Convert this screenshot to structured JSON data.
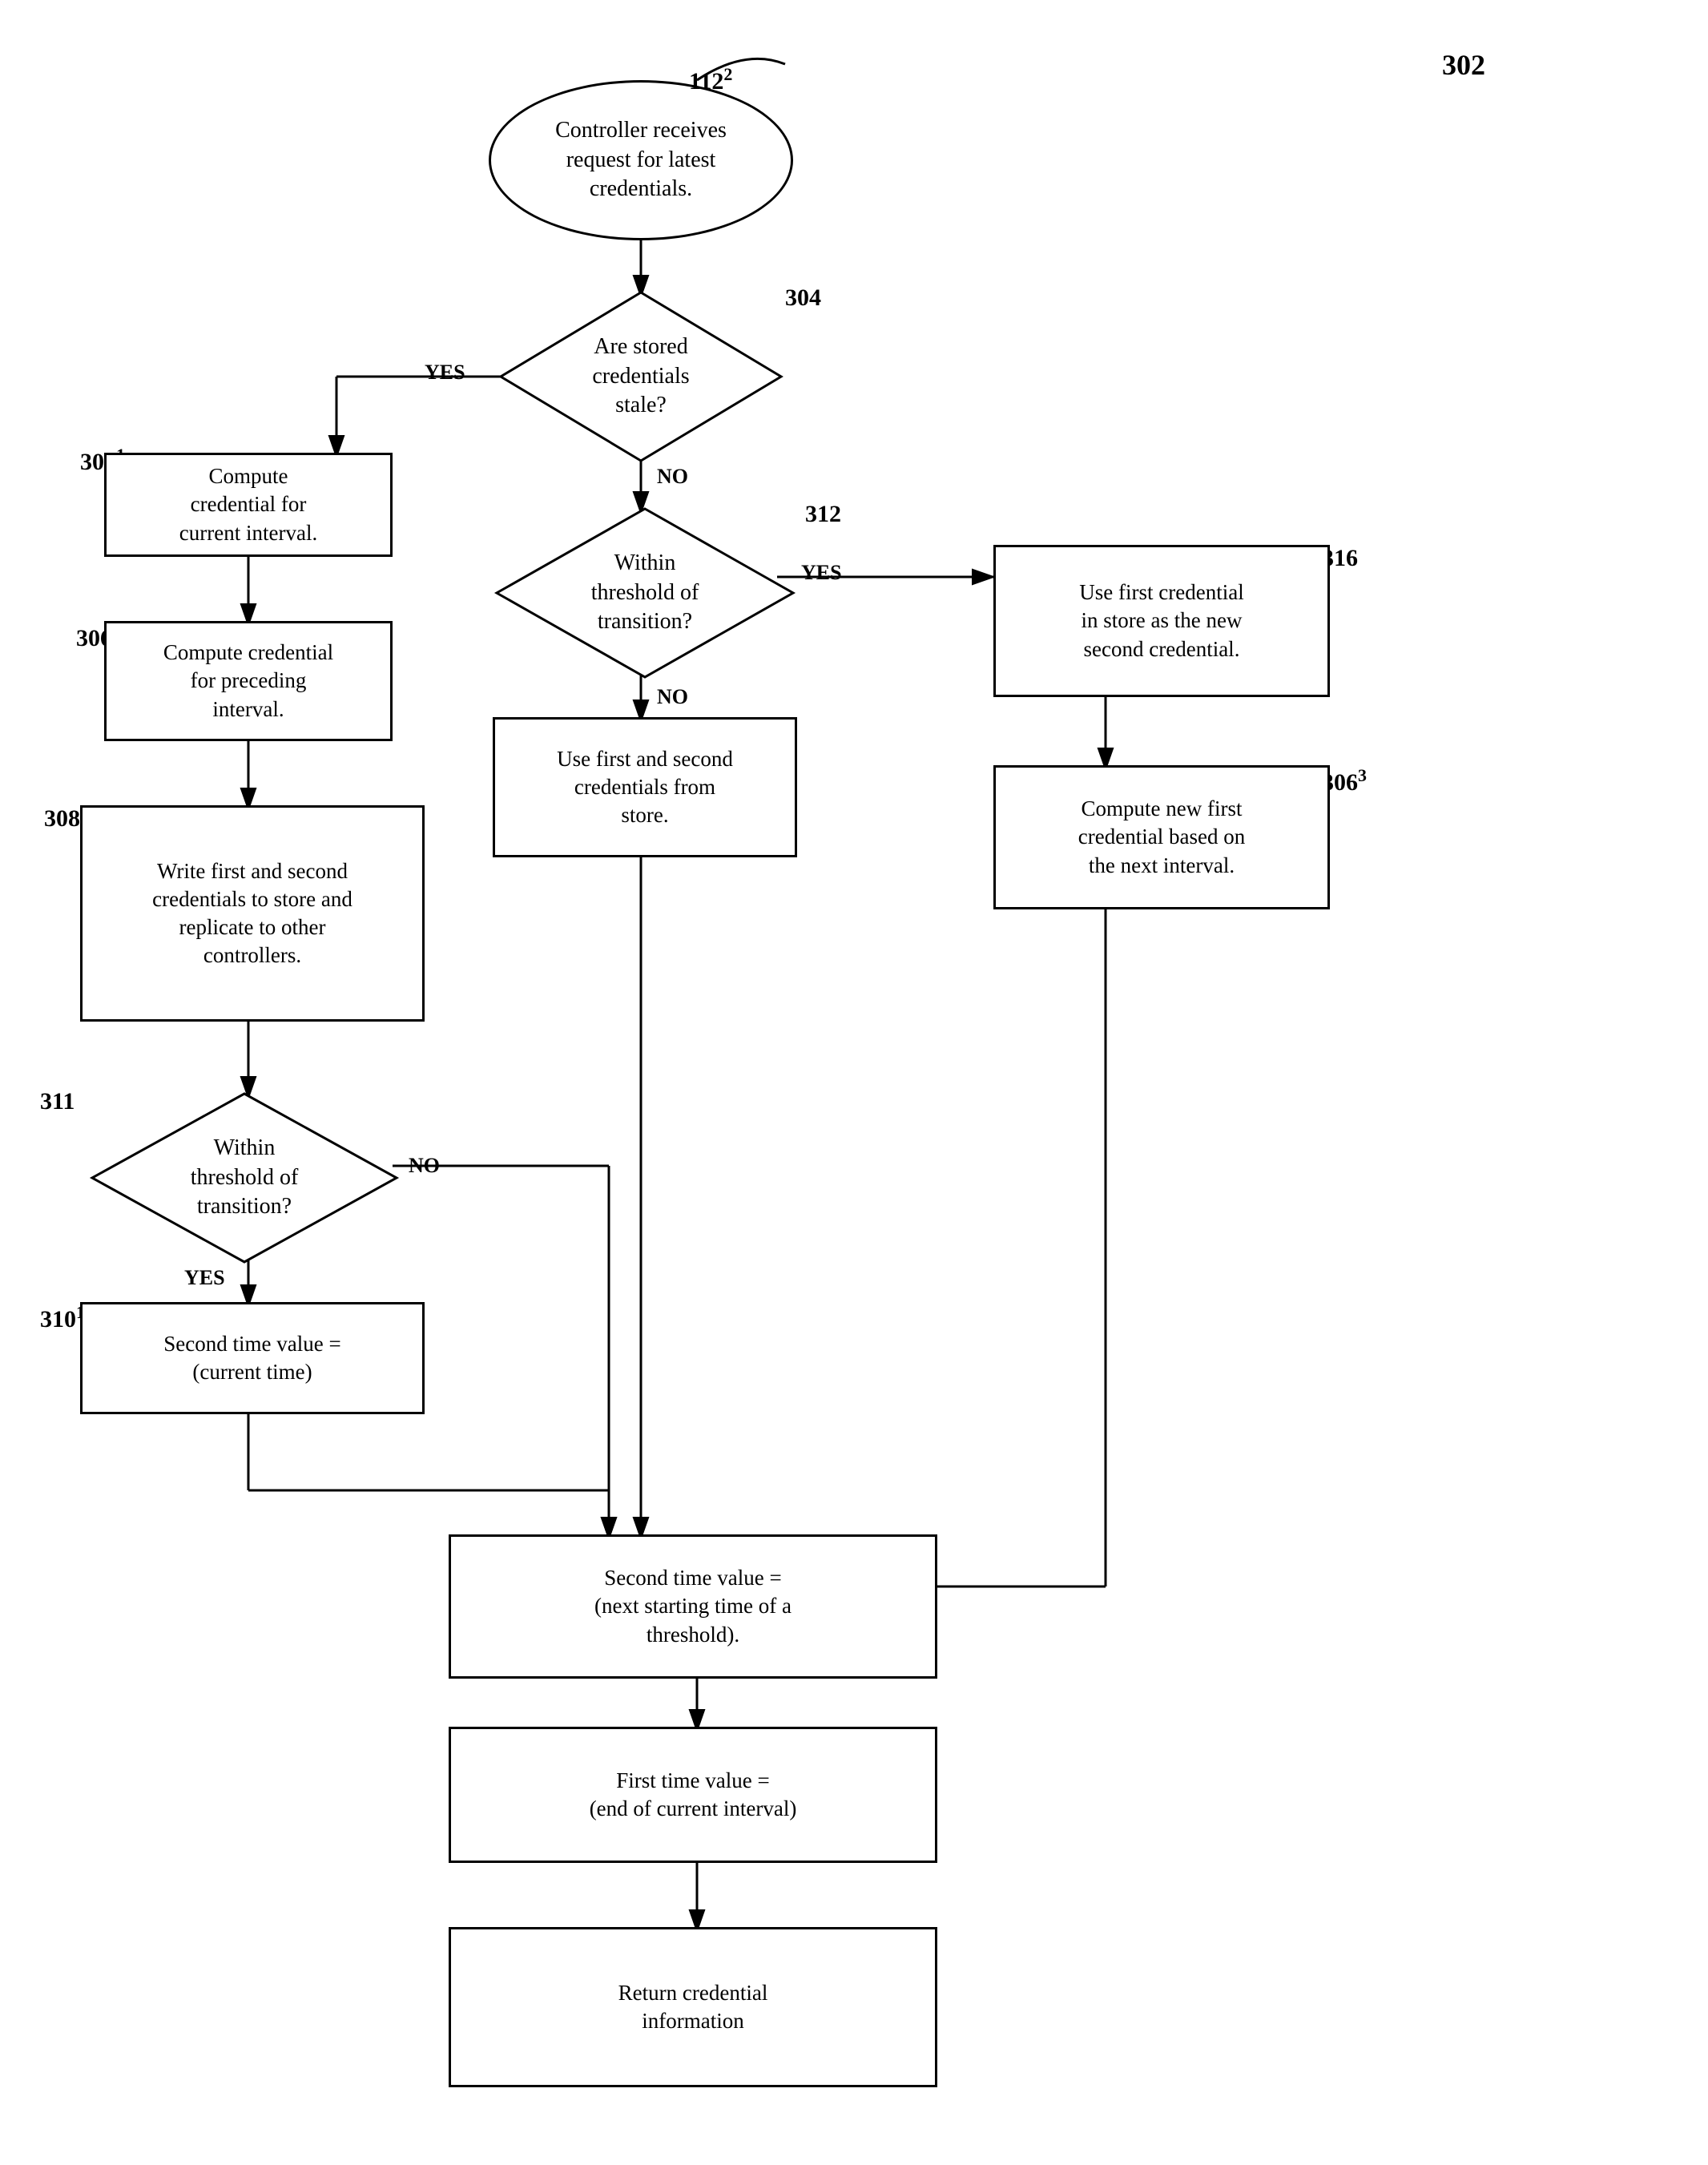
{
  "diagram": {
    "title": "Flowchart 302",
    "nodes": {
      "start": {
        "label": "Controller receives\nrequest for latest\ncredentials.",
        "id": "112_2",
        "type": "oval"
      },
      "d304": {
        "label": "Are stored\ncredentials\nstale?",
        "id": "304",
        "type": "diamond"
      },
      "b306_1": {
        "label": "Compute\ncredential for\ncurrent interval.",
        "id": "306_1",
        "type": "rect"
      },
      "b306_2": {
        "label": "Compute credential\nfor preceding\ninterval.",
        "id": "306_2",
        "type": "rect"
      },
      "b308": {
        "label": "Write first and second\ncredentials to store and\nreplicate to other\ncontrollers.",
        "id": "308",
        "type": "rect"
      },
      "d311": {
        "label": "Within\nthreshold of\ntransition?",
        "id": "311",
        "type": "diamond"
      },
      "b310_1": {
        "label": "Second time value =\n(current time)",
        "id": "310_1",
        "type": "rect"
      },
      "d312": {
        "label": "Within\nthreshold of\ntransition?",
        "id": "312",
        "type": "diamond"
      },
      "b314": {
        "label": "Use first and second\ncredentials from\nstore.",
        "id": "314",
        "type": "rect"
      },
      "b316": {
        "label": "Use first credential\nin store as the new\nsecond credential.",
        "id": "316",
        "type": "rect"
      },
      "b306_3": {
        "label": "Compute new first\ncredential based on\nthe next interval.",
        "id": "306_3",
        "type": "rect"
      },
      "b310_2": {
        "label": "Second time value =\n(next starting time of a\nthreshold).",
        "id": "310_2",
        "type": "rect"
      },
      "b309": {
        "label": "First time value =\n(end of current interval)",
        "id": "309",
        "type": "rect"
      },
      "end": {
        "label": "Return credential\ninformation",
        "id": "114_2",
        "type": "rect"
      }
    },
    "labels": {
      "main_ref": "302",
      "yes_304": "YES",
      "no_304": "NO",
      "yes_312": "YES",
      "no_312": "NO",
      "yes_311": "YES",
      "no_311": "NO"
    }
  }
}
